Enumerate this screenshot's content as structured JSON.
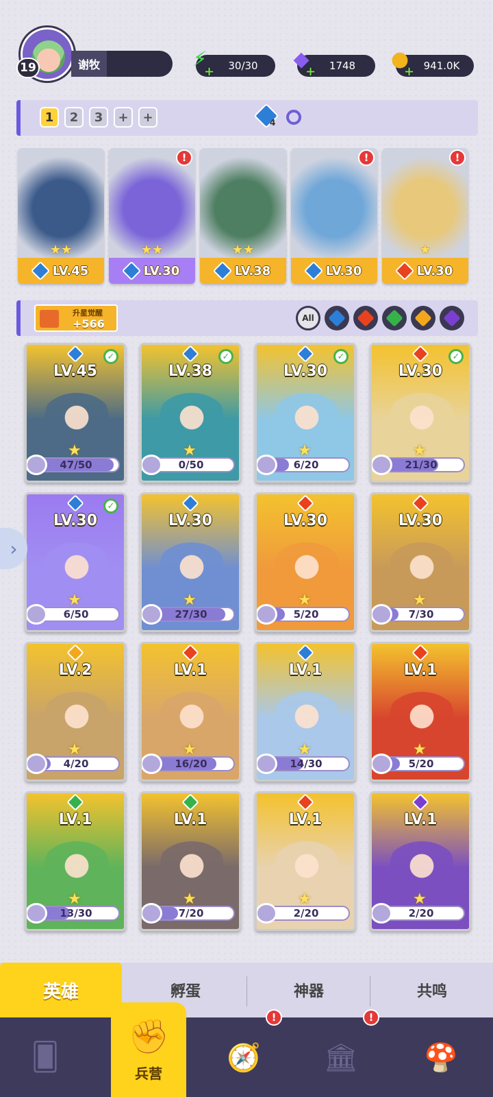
{
  "player": {
    "level": "19",
    "name": "谢牧"
  },
  "resources": [
    {
      "name": "energy",
      "value": "30/30",
      "icon": "lightning-icon",
      "color": "#3fdc4a"
    },
    {
      "name": "gems",
      "value": "1748",
      "icon": "diamond-icon",
      "color": "#8a5cf0"
    },
    {
      "name": "coins",
      "value": "941.0K",
      "icon": "coin-icon",
      "color": "#f2b41c"
    }
  ],
  "team": {
    "tabs": [
      "1",
      "2",
      "3",
      "+",
      "+"
    ],
    "active": "1",
    "gem_count": "4"
  },
  "team_heroes": [
    {
      "level": "LV.45",
      "element": "water",
      "stars": 2,
      "alert": false,
      "art": "#3b5a8a"
    },
    {
      "level": "LV.30",
      "element": "water",
      "stars": 2,
      "alert": true,
      "art": "#7a64d8"
    },
    {
      "level": "LV.38",
      "element": "water",
      "stars": 2,
      "alert": false,
      "art": "#4f7f62"
    },
    {
      "level": "LV.30",
      "element": "water",
      "stars": 0,
      "alert": true,
      "art": "#6fa7d8"
    },
    {
      "level": "LV.30",
      "element": "fire",
      "stars": 1,
      "alert": true,
      "art": "#e8c87a"
    }
  ],
  "awaken": {
    "label": "升星觉醒",
    "value": "+566"
  },
  "filters": [
    "All",
    "water",
    "fire",
    "nature",
    "light",
    "dark"
  ],
  "heroes": [
    {
      "level": "LV.45",
      "element": "water",
      "progress": "47/50",
      "pct": 0.94,
      "check": true,
      "bg": "#f3c22e",
      "art": "#4d6b86"
    },
    {
      "level": "LV.38",
      "element": "water",
      "progress": "0/50",
      "pct": 0.0,
      "check": true,
      "bg": "#f3c22e",
      "art": "#3d9aa6"
    },
    {
      "level": "LV.30",
      "element": "water",
      "progress": "6/20",
      "pct": 0.3,
      "check": true,
      "bg": "#f3c22e",
      "art": "#8fc7e6"
    },
    {
      "level": "LV.30",
      "element": "fire",
      "progress": "21/30",
      "pct": 0.7,
      "check": true,
      "bg": "#f3c22e",
      "art": "#e8d39a"
    },
    {
      "level": "LV.30",
      "element": "water",
      "progress": "6/50",
      "pct": 0.12,
      "check": true,
      "bg": "#9b7bf0",
      "art": "#a18ef2"
    },
    {
      "level": "LV.30",
      "element": "water",
      "progress": "27/30",
      "pct": 0.9,
      "check": false,
      "bg": "#f3c22e",
      "art": "#6f8fd2"
    },
    {
      "level": "LV.30",
      "element": "fire",
      "progress": "5/20",
      "pct": 0.25,
      "check": false,
      "bg": "#f3c22e",
      "art": "#f09a3c"
    },
    {
      "level": "LV.30",
      "element": "fire",
      "progress": "7/30",
      "pct": 0.23,
      "check": false,
      "bg": "#f3c22e",
      "art": "#c89a5a"
    },
    {
      "level": "LV.2",
      "element": "light",
      "progress": "4/20",
      "pct": 0.2,
      "check": false,
      "bg": "#f3c22e",
      "art": "#c8a36a"
    },
    {
      "level": "LV.1",
      "element": "fire",
      "progress": "16/20",
      "pct": 0.8,
      "check": false,
      "bg": "#f3c22e",
      "art": "#d9a66a"
    },
    {
      "level": "LV.1",
      "element": "water",
      "progress": "14/30",
      "pct": 0.47,
      "check": false,
      "bg": "#f3c22e",
      "art": "#a9c8ea"
    },
    {
      "level": "LV.1",
      "element": "fire",
      "progress": "5/20",
      "pct": 0.25,
      "check": false,
      "bg": "#f3c22e",
      "art": "#d8452e"
    },
    {
      "level": "LV.1",
      "element": "nature",
      "progress": "13/30",
      "pct": 0.43,
      "check": false,
      "bg": "#f3c22e",
      "art": "#5fb35a"
    },
    {
      "level": "LV.1",
      "element": "nature",
      "progress": "7/20",
      "pct": 0.35,
      "check": false,
      "bg": "#f3c22e",
      "art": "#7a6a6a"
    },
    {
      "level": "LV.1",
      "element": "fire",
      "progress": "2/20",
      "pct": 0.1,
      "check": false,
      "bg": "#f3c22e",
      "art": "#e8d2b0"
    },
    {
      "level": "LV.1",
      "element": "dark",
      "progress": "2/20",
      "pct": 0.1,
      "check": false,
      "bg": "#f3c22e",
      "art": "#7b4fc0"
    }
  ],
  "subtabs": [
    "英雄",
    "孵蛋",
    "神器",
    "共鸣"
  ],
  "nav": {
    "active_label": "兵营",
    "items": [
      "cards-icon",
      "barracks-icon",
      "map-icon",
      "castle-icon",
      "mushroom-icon"
    ]
  }
}
